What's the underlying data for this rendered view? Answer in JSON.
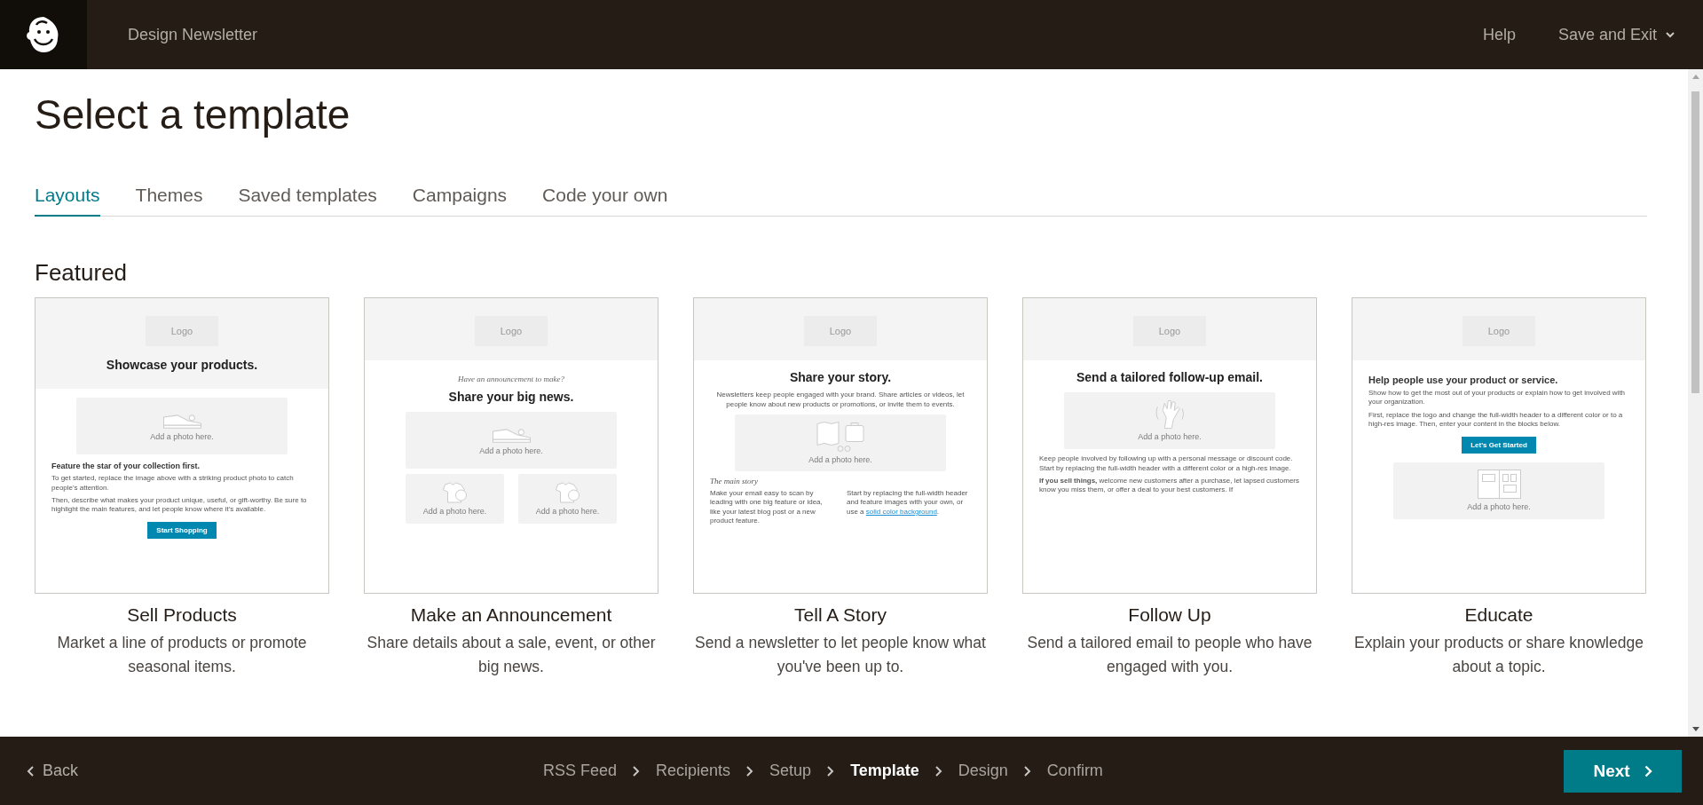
{
  "top_bar": {
    "campaign_name": "Design Newsletter",
    "help": "Help",
    "save_menu": "Save and Exit"
  },
  "title": "Select a template",
  "tabs": [
    {
      "label": "Layouts",
      "selected": true
    },
    {
      "label": "Themes",
      "selected": false
    },
    {
      "label": "Saved templates",
      "selected": false
    },
    {
      "label": "Campaigns",
      "selected": false
    },
    {
      "label": "Code your own",
      "selected": false
    }
  ],
  "section_title": "Featured",
  "templates": [
    {
      "name": "Sell Products",
      "description": "Market a line of products or promote seasonal items.",
      "preview": {
        "header": [
          {
            "kind": "logo",
            "text": "Logo"
          },
          {
            "kind": "heading",
            "text": "Showcase your products."
          }
        ],
        "body": [
          {
            "kind": "photo",
            "text": "Add a photo here."
          },
          {
            "kind": "subheading",
            "text": "Feature the star of your collection first."
          },
          {
            "kind": "text",
            "text": "To get started, replace the image above with a striking product photo to catch people's attention."
          },
          {
            "kind": "text",
            "text": "Then, describe what makes your product unique, useful, or gift-worthy. Be sure to highlight the main features, and let people know where it's available."
          },
          {
            "kind": "button",
            "text": "Start Shopping"
          }
        ]
      }
    },
    {
      "name": "Make an Announcement",
      "description": "Share details about a sale, event, or other big news.",
      "preview": {
        "header": [
          {
            "kind": "logo",
            "text": "Logo"
          }
        ],
        "body": [
          {
            "kind": "kicker",
            "text": "Have an announcement to make?"
          },
          {
            "kind": "heading",
            "text": "Share your big news."
          },
          {
            "kind": "photo",
            "text": "Add a photo here."
          },
          {
            "kind": "photo_pair",
            "texts": [
              "Add a photo here.",
              "Add a photo here."
            ]
          }
        ]
      }
    },
    {
      "name": "Tell A Story",
      "description": "Send a newsletter to let people know what you've been up to.",
      "preview": {
        "header": [
          {
            "kind": "logo",
            "text": "Logo"
          }
        ],
        "body": [
          {
            "kind": "heading",
            "text": "Share your story."
          },
          {
            "kind": "intro",
            "text": "Newsletters keep people engaged with your brand. Share articles or videos, let people know about new products or promotions, or invite them to events."
          },
          {
            "kind": "photo",
            "text": "Add a photo here."
          },
          {
            "kind": "section_label",
            "text": "The main story"
          },
          {
            "kind": "columns",
            "left": "Make your email easy to scan by leading with one big feature or idea, like your latest blog post or a new product feature.",
            "right": "Start by replacing the full-width header and feature images with your own, or use a",
            "link": "solid color background",
            "after": "."
          }
        ]
      }
    },
    {
      "name": "Follow Up",
      "description": "Send a tailored email to people who have engaged with you.",
      "preview": {
        "header": [
          {
            "kind": "logo",
            "text": "Logo"
          }
        ],
        "body": [
          {
            "kind": "heading",
            "text": "Send a tailored follow-up email."
          },
          {
            "kind": "photo",
            "text": "Add a photo here."
          },
          {
            "kind": "text",
            "text": "Keep people involved by following up with a personal message or discount code. Start by replacing the full-width header with a different color or a high-res image."
          },
          {
            "kind": "text",
            "text": "**If you sell things,** welcome new customers after a purchase, let lapsed customers know you miss them, or offer a deal to your best customers. If"
          }
        ]
      }
    },
    {
      "name": "Educate",
      "description": "Explain your products or share knowledge about a topic.",
      "preview": {
        "header": [
          {
            "kind": "logo",
            "text": "Logo"
          }
        ],
        "body": [
          {
            "kind": "lead",
            "text": "Help people use your product or service."
          },
          {
            "kind": "text",
            "text": "Show how to get the most out of your products or explain how to get involved with your organization."
          },
          {
            "kind": "text",
            "text": "First, replace the logo and change the full-width header to a different color or to a high-res image. Then, enter your content in the blocks below."
          },
          {
            "kind": "button",
            "text": "Let's Get Started"
          },
          {
            "kind": "photo",
            "text": "Add a photo here."
          }
        ]
      }
    }
  ],
  "footer": {
    "back": "Back",
    "steps": [
      {
        "label": "RSS Feed",
        "selected": false
      },
      {
        "label": "Recipients",
        "selected": false
      },
      {
        "label": "Setup",
        "selected": false
      },
      {
        "label": "Template",
        "selected": true
      },
      {
        "label": "Design",
        "selected": false
      },
      {
        "label": "Confirm",
        "selected": false
      }
    ],
    "next": "Next"
  }
}
